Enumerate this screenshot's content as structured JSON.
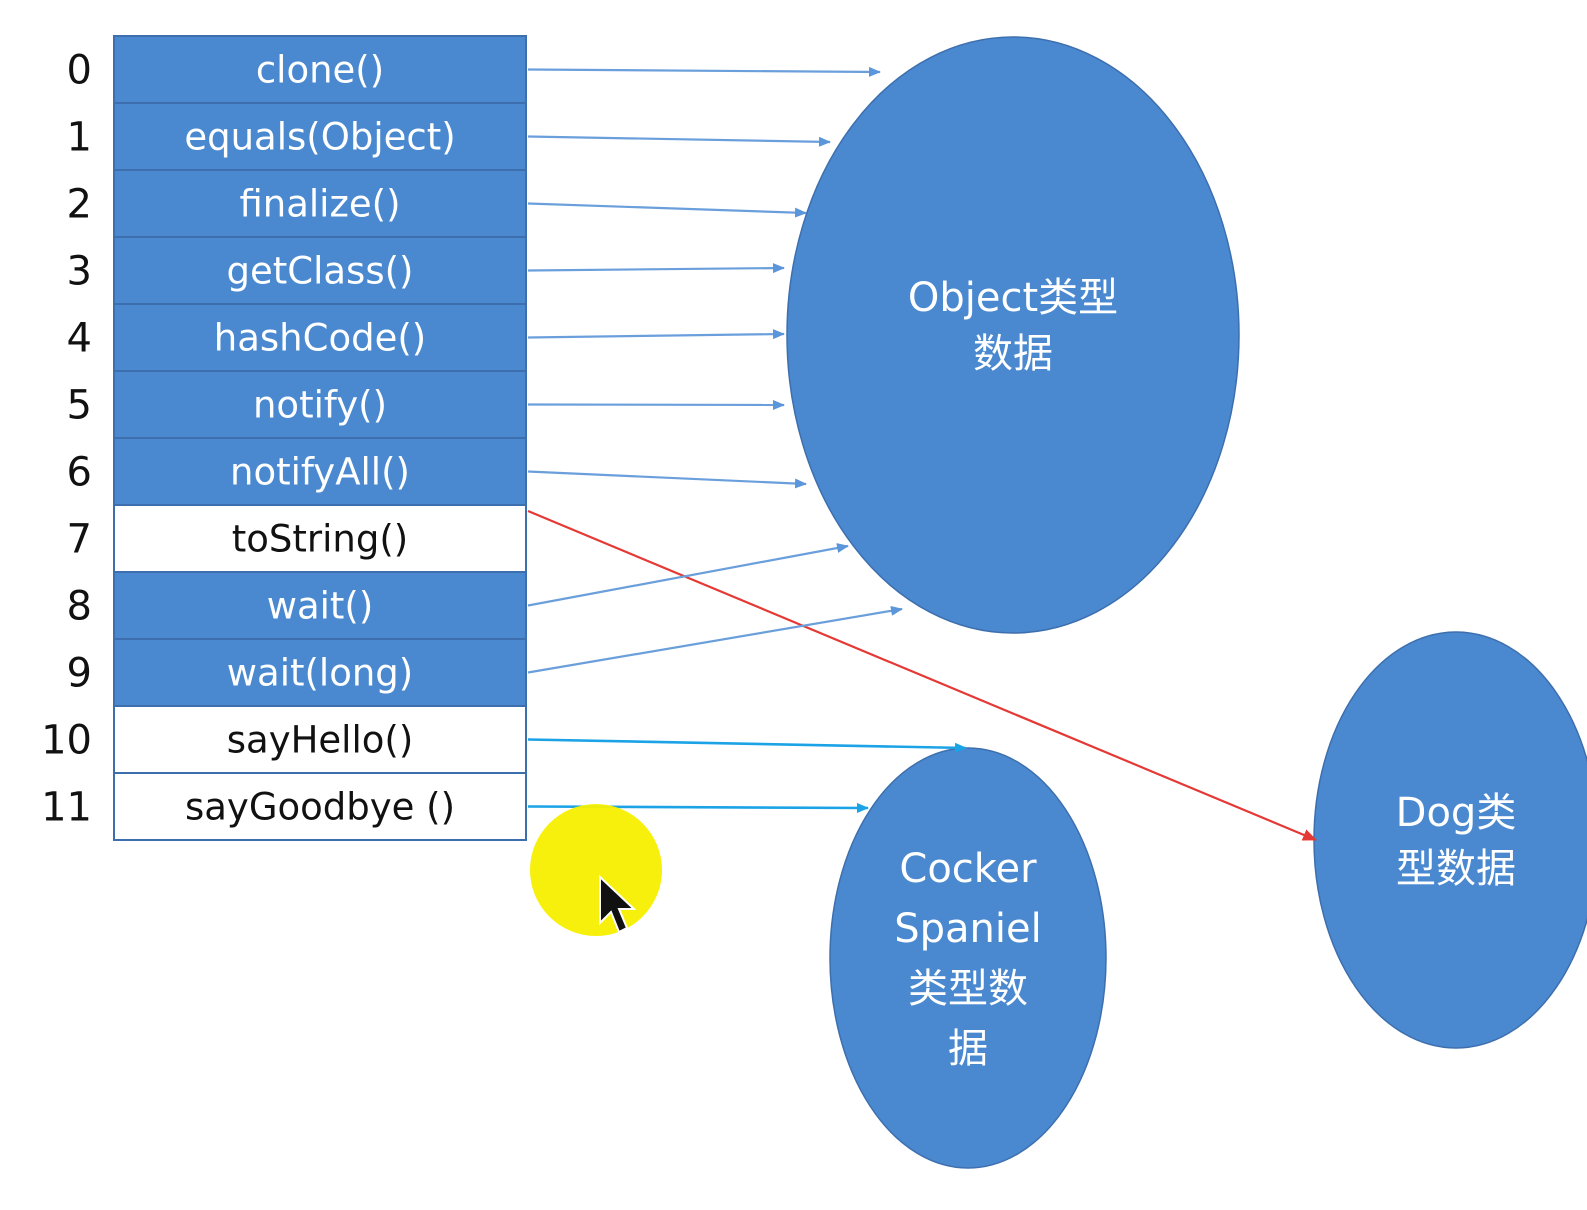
{
  "vtable": {
    "rows": [
      {
        "index": "0",
        "label": "clone()",
        "filled": true,
        "target": "object"
      },
      {
        "index": "1",
        "label": "equals(Object)",
        "filled": true,
        "target": "object"
      },
      {
        "index": "2",
        "label": "finalize()",
        "filled": true,
        "target": "object"
      },
      {
        "index": "3",
        "label": "getClass()",
        "filled": true,
        "target": "object"
      },
      {
        "index": "4",
        "label": "hashCode()",
        "filled": true,
        "target": "object"
      },
      {
        "index": "5",
        "label": "notify()",
        "filled": true,
        "target": "object"
      },
      {
        "index": "6",
        "label": "notifyAll()",
        "filled": true,
        "target": "object"
      },
      {
        "index": "7",
        "label": "toString()",
        "filled": false,
        "target": "dog"
      },
      {
        "index": "8",
        "label": "wait()",
        "filled": true,
        "target": "object"
      },
      {
        "index": "9",
        "label": "wait(long)",
        "filled": true,
        "target": "object"
      },
      {
        "index": "10",
        "label": "sayHello()",
        "filled": false,
        "target": "cocker"
      },
      {
        "index": "11",
        "label": "sayGoodbye ()",
        "filled": false,
        "target": "cocker"
      }
    ]
  },
  "nodes": {
    "object": {
      "lines": [
        "Object类型",
        "数据"
      ]
    },
    "cocker": {
      "lines": [
        "Cocker",
        "Spaniel",
        "类型数",
        "据"
      ]
    },
    "dog": {
      "lines": [
        "Dog类",
        "型数据"
      ]
    }
  },
  "colors": {
    "fill": "#4a89d0",
    "border": "#3d6fae",
    "arrow_object": "#6a9fdc",
    "arrow_cocker": "#1ba3e6",
    "arrow_override": "#e53935",
    "cursor_highlight": "#f7ef00"
  }
}
